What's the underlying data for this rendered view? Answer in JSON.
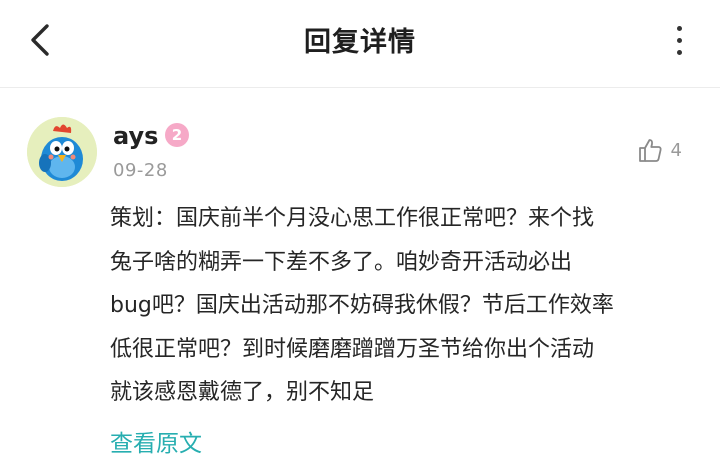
{
  "header": {
    "title": "回复详情"
  },
  "comment": {
    "username": "ays",
    "level": "2",
    "date": "09-28",
    "likes": "4",
    "content_lines": [
      "策划：国庆前半个月没心思工作很正常吧？来个找",
      "兔子啥的糊弄一下差不多了。咱妙奇开活动必出",
      "bug吧？国庆出活动那不妨碍我休假？节后工作效率",
      "低很正常吧？到时候磨磨蹭蹭万圣节给你出个活动",
      "就该感恩戴德了，别不知足"
    ],
    "view_original": "查看原文"
  },
  "colors": {
    "link": "#27aeb0",
    "badge": "#f6a9c7",
    "muted": "#9a9a9a"
  },
  "icons": [
    "back-arrow-icon",
    "more-vertical-icon",
    "thumbs-up-icon",
    "avatar-chicken"
  ]
}
